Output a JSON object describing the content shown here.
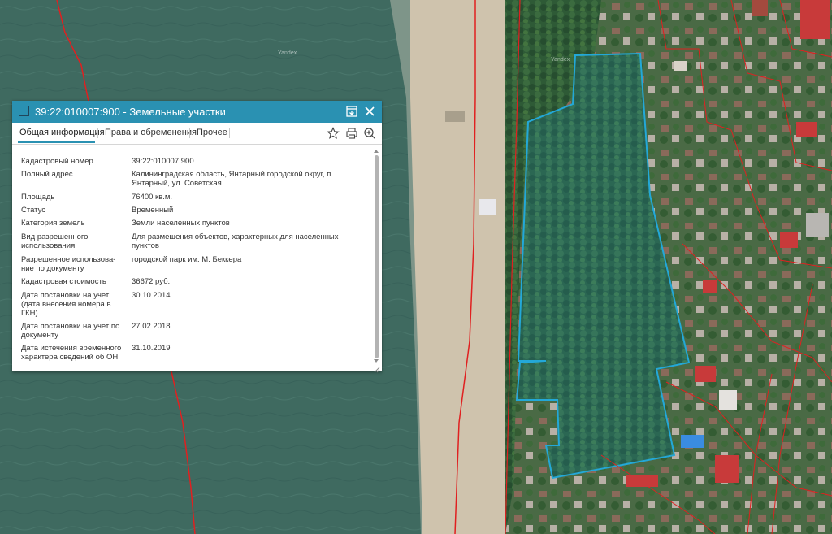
{
  "map": {
    "watermark": "Yandex",
    "colors": {
      "sea": "#3f6b5f",
      "sand": "#cfc3ad",
      "forest": "#2f5a3a",
      "parcel_outline": "#23a8d8",
      "boundary": "#e02020"
    }
  },
  "panel": {
    "title": "39:22:010007:900 - Земельные участки",
    "icons": {
      "pin": "pin-panel-icon",
      "close": "close-icon"
    },
    "accent_color": "#2a91b2"
  },
  "tabs": [
    {
      "label": "Общая информация",
      "active": true
    },
    {
      "label": "Права и обременения",
      "active": false
    },
    {
      "label": "Прочее",
      "active": false
    }
  ],
  "tools": {
    "favorite": "star-icon",
    "print": "printer-icon",
    "zoom": "zoom-in-icon"
  },
  "rows": [
    {
      "label": "Кадастровый номер",
      "value": "39:22:010007:900"
    },
    {
      "label": "Полный адрес",
      "value": "Калининградская область, Янтарный городской округ, п. Янтарный, ул. Советская"
    },
    {
      "label": "Площадь",
      "value": "76400 кв.м."
    },
    {
      "label": "Статус",
      "value": "Временный"
    },
    {
      "label": "Категория земель",
      "value": "Земли населенных пунктов"
    },
    {
      "label": "Вид разрешенного использования",
      "value": "Для размещения объектов, характерных для населенных пунктов"
    },
    {
      "label": "Разрешенное использова-ние по документу",
      "value": "городской парк им. М. Беккера"
    },
    {
      "label": "Кадастровая стоимость",
      "value": "36672 руб."
    },
    {
      "label": "Дата постановки на учет (дата внесения номера в ГКН)",
      "value": "30.10.2014"
    },
    {
      "label": "Дата постановки на учет по документу",
      "value": "27.02.2018"
    },
    {
      "label": "Дата истечения временного характера сведений об ОН",
      "value": "31.10.2019"
    }
  ]
}
